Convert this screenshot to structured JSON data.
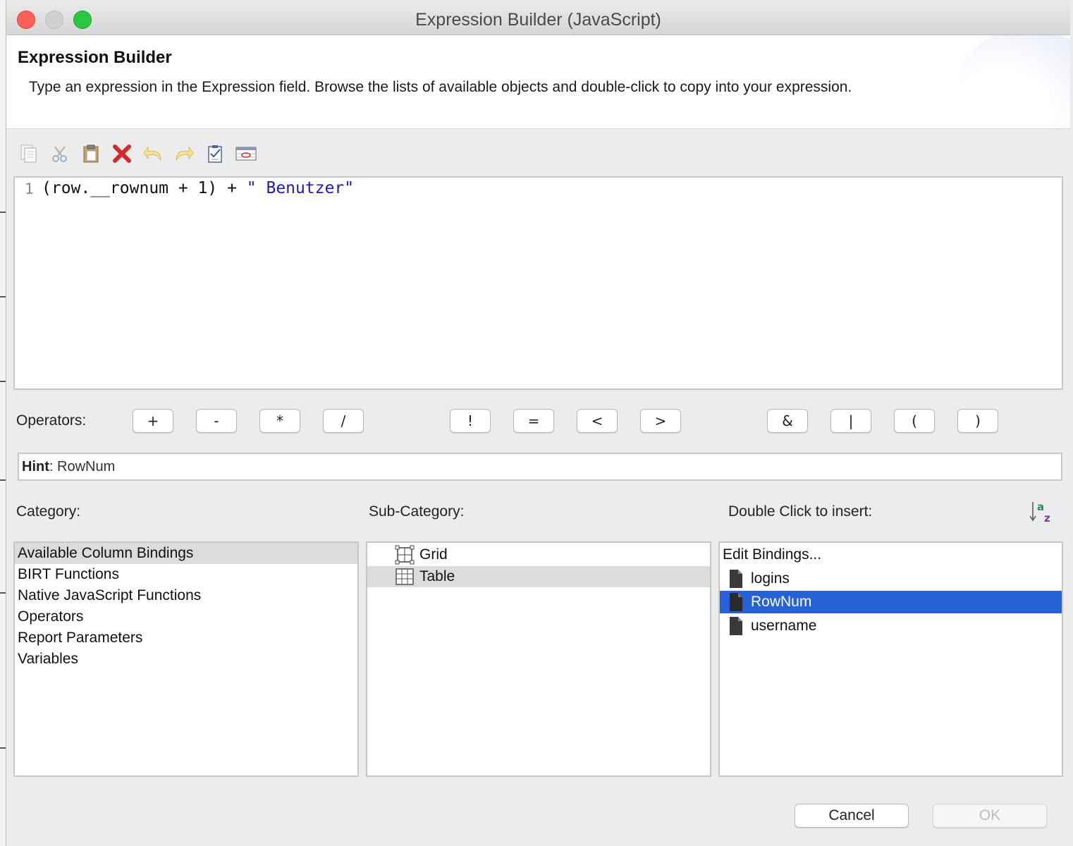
{
  "window": {
    "title": "Expression Builder (JavaScript)"
  },
  "header": {
    "title": "Expression Builder",
    "description": "Type an expression in the Expression field. Browse the lists of available objects and double-click to copy into your expression."
  },
  "toolbar": {
    "items": [
      {
        "icon": "copy-icon"
      },
      {
        "icon": "cut-icon"
      },
      {
        "icon": "paste-icon"
      },
      {
        "icon": "delete-icon",
        "color": "#d62a2a"
      },
      {
        "icon": "undo-icon"
      },
      {
        "icon": "redo-icon"
      },
      {
        "icon": "validate-icon"
      },
      {
        "icon": "calculate-icon"
      }
    ]
  },
  "editor": {
    "line_number": "1",
    "code_part1": "(row.__rownum + 1) + ",
    "code_string": "\" Benutzer\"",
    "string_color": "#1a1ac8"
  },
  "operators": {
    "label": "Operators:",
    "buttons": [
      "+",
      "-",
      "*",
      "/",
      "!",
      "=",
      "<",
      ">",
      "&",
      "|",
      "(",
      ")"
    ]
  },
  "hint": {
    "label": "Hint",
    "value": ": RowNum"
  },
  "category": {
    "label": "Category:",
    "items": [
      "Available Column Bindings",
      "BIRT Functions",
      "Native JavaScript Functions",
      "Operators",
      "Report Parameters",
      "Variables"
    ],
    "selected_index": 0
  },
  "subcategory": {
    "label": "Sub-Category:",
    "items": [
      {
        "label": "Grid",
        "icon": "grid-icon"
      },
      {
        "label": "Table",
        "icon": "table-icon"
      }
    ],
    "selected_index": 1
  },
  "insert": {
    "label": "Double Click to insert:",
    "sort_icon": "sort-az-icon",
    "items": [
      {
        "label": "Edit Bindings...",
        "icon": ""
      },
      {
        "label": "logins",
        "icon": "file-icon"
      },
      {
        "label": "RowNum",
        "icon": "file-icon"
      },
      {
        "label": "username",
        "icon": "file-icon"
      }
    ],
    "selected_index": 2,
    "selection_color": "#2661d8"
  },
  "buttons": {
    "cancel": "Cancel",
    "ok": "OK"
  }
}
